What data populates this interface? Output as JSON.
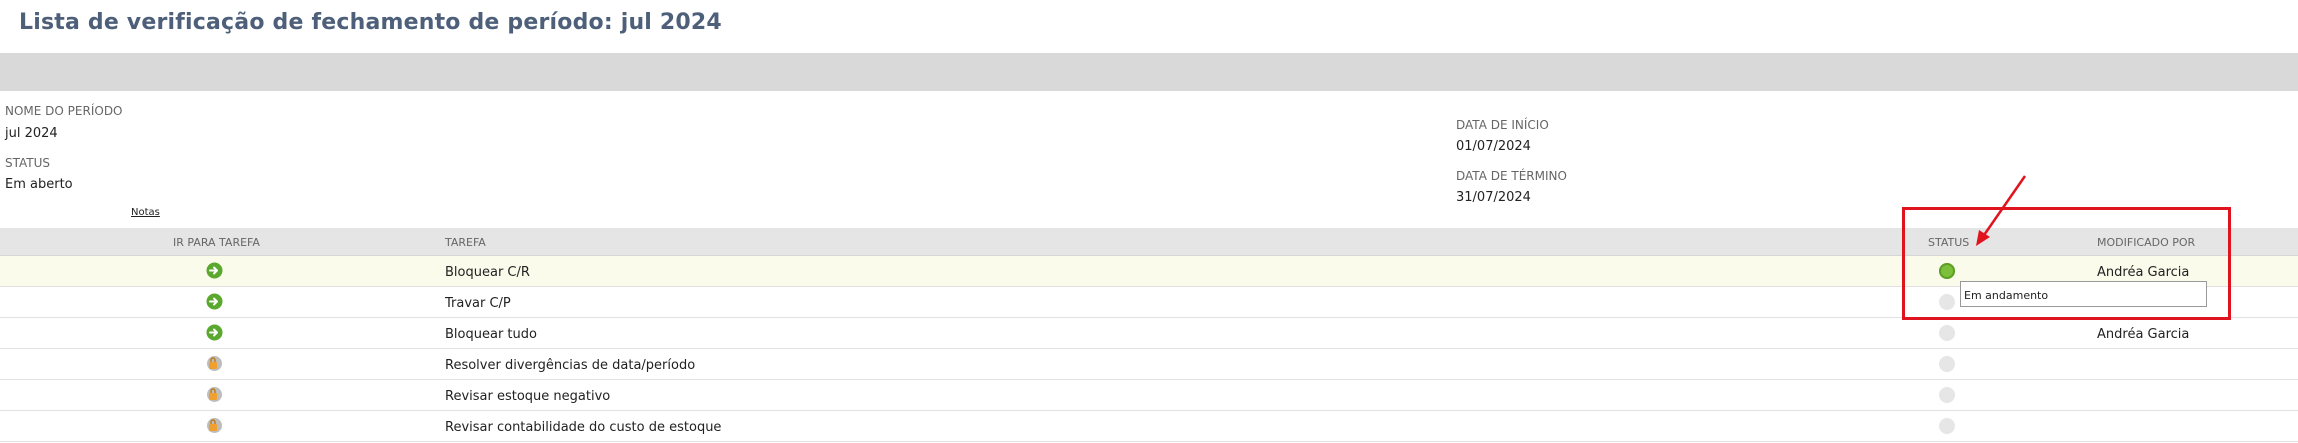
{
  "page": {
    "title": "Lista de verificação de fechamento de período: jul 2024"
  },
  "period": {
    "name_label": "NOME DO PERÍODO",
    "name_value": "jul 2024",
    "status_label": "STATUS",
    "status_value": "Em aberto",
    "start_label": "DATA DE INÍCIO",
    "start_value": "01/07/2024",
    "end_label": "DATA DE TÉRMINO",
    "end_value": "31/07/2024",
    "notes_link": "Notas"
  },
  "grid": {
    "columns": {
      "goto": "IR PARA TAREFA",
      "task": "TAREFA",
      "status": "STATUS",
      "modified_by": "MODIFICADO POR"
    },
    "rows": [
      {
        "goto_icon": "green-arrow-icon",
        "task": "Bloquear C/R",
        "status": "complete",
        "modified_by": "Andréa Garcia"
      },
      {
        "goto_icon": "green-arrow-icon",
        "task": "Travar C/P",
        "status": "pending",
        "modified_by": ""
      },
      {
        "goto_icon": "green-arrow-icon",
        "task": "Bloquear tudo",
        "status": "pending",
        "modified_by": "Andréa Garcia"
      },
      {
        "goto_icon": "locked-task-icon",
        "task": "Resolver divergências de data/período",
        "status": "pending",
        "modified_by": ""
      },
      {
        "goto_icon": "locked-task-icon",
        "task": "Revisar estoque negativo",
        "status": "pending",
        "modified_by": ""
      },
      {
        "goto_icon": "locked-task-icon",
        "task": "Revisar contabilidade do custo de estoque",
        "status": "pending",
        "modified_by": ""
      }
    ]
  },
  "tooltip": {
    "text": "Em andamento"
  },
  "colors": {
    "title": "#4d5f79",
    "band": "#d9d9d9",
    "highlight_row": "#fafbeb",
    "status_complete": "#7cbf3a",
    "callout": "#e0141e"
  }
}
